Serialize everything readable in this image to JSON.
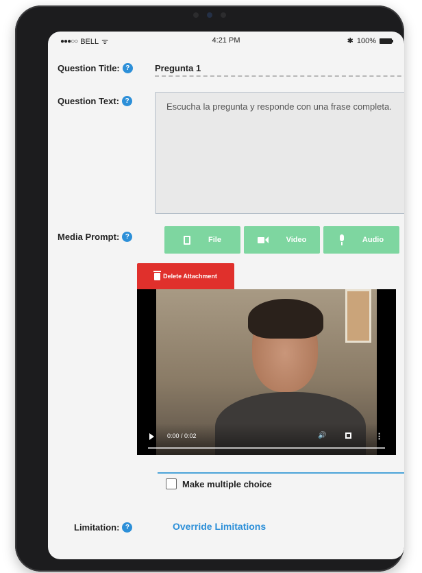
{
  "status_bar": {
    "carrier": "BELL",
    "time": "4:21 PM",
    "battery": "100%"
  },
  "labels": {
    "question_title": "Question Title:",
    "question_text": "Question Text:",
    "media_prompt": "Media Prompt:",
    "limitation": "Limitation:",
    "help_icon": "?"
  },
  "fields": {
    "question_title_value": "Pregunta 1",
    "question_text_value": "Escucha la pregunta y responde con una frase completa."
  },
  "media_buttons": {
    "file": "File",
    "video": "Video",
    "audio": "Audio"
  },
  "attachment": {
    "delete_label": "Delete Attachment"
  },
  "video_player": {
    "time": "0:00 / 0:02",
    "progress_fraction": 0.0
  },
  "options": {
    "multiple_choice_label": "Make multiple choice",
    "multiple_choice_checked": false
  },
  "links": {
    "override_limitations": "Override Limitations"
  },
  "colors": {
    "accent_blue": "#2c8fd8",
    "media_green": "#7ed6a0",
    "delete_red": "#e0302c"
  }
}
